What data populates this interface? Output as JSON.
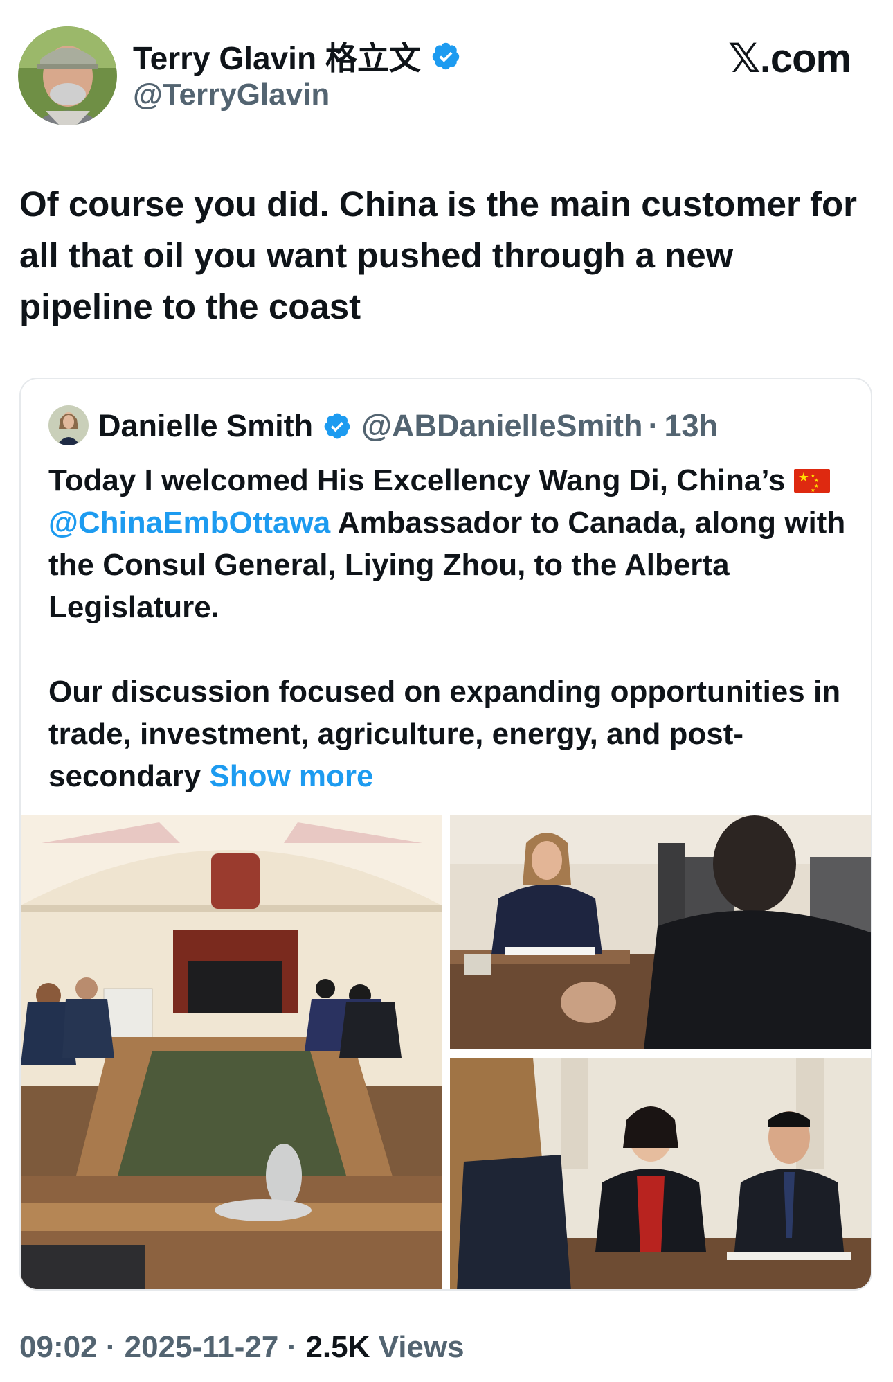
{
  "site": {
    "logo": "𝕏.com"
  },
  "author": {
    "name": "Terry Glavin 格立文",
    "handle": "@TerryGlavin",
    "verified_icon": "verified-badge-icon",
    "avatar": "avatar-photo"
  },
  "tweet": {
    "text": "Of course you did. China is the main customer for all that oil you want pushed through a new pipeline to the coast"
  },
  "quoted": {
    "name": "Danielle Smith",
    "handle": "@ABDanielleSmith",
    "separator": "·",
    "time": "13h",
    "para1_a": "Today I welcomed His Excellency Wang Di, China’s",
    "flag_icon": "china-flag-icon",
    "mention": "@ChinaEmbOttawa",
    "para1_b": " Ambassador to Canada, along with the Consul General, Liying Zhou, to the Alberta Legislature.",
    "para2": "Our discussion focused on expanding opportunities in trade, investment, agriculture, energy, and post-secondary ",
    "show_more": "Show more",
    "photos": [
      "meeting-room-photo",
      "premier-at-table-photo",
      "ambassador-and-consul-photo"
    ]
  },
  "meta": {
    "time": "09:02",
    "date": "2025-11-27",
    "separator": "·",
    "views_count": "2.5K",
    "views_label": "Views"
  },
  "colors": {
    "link": "#1d9bf0",
    "secondary": "#536471",
    "text": "#0f1419",
    "verified": "#1d9bf0"
  }
}
